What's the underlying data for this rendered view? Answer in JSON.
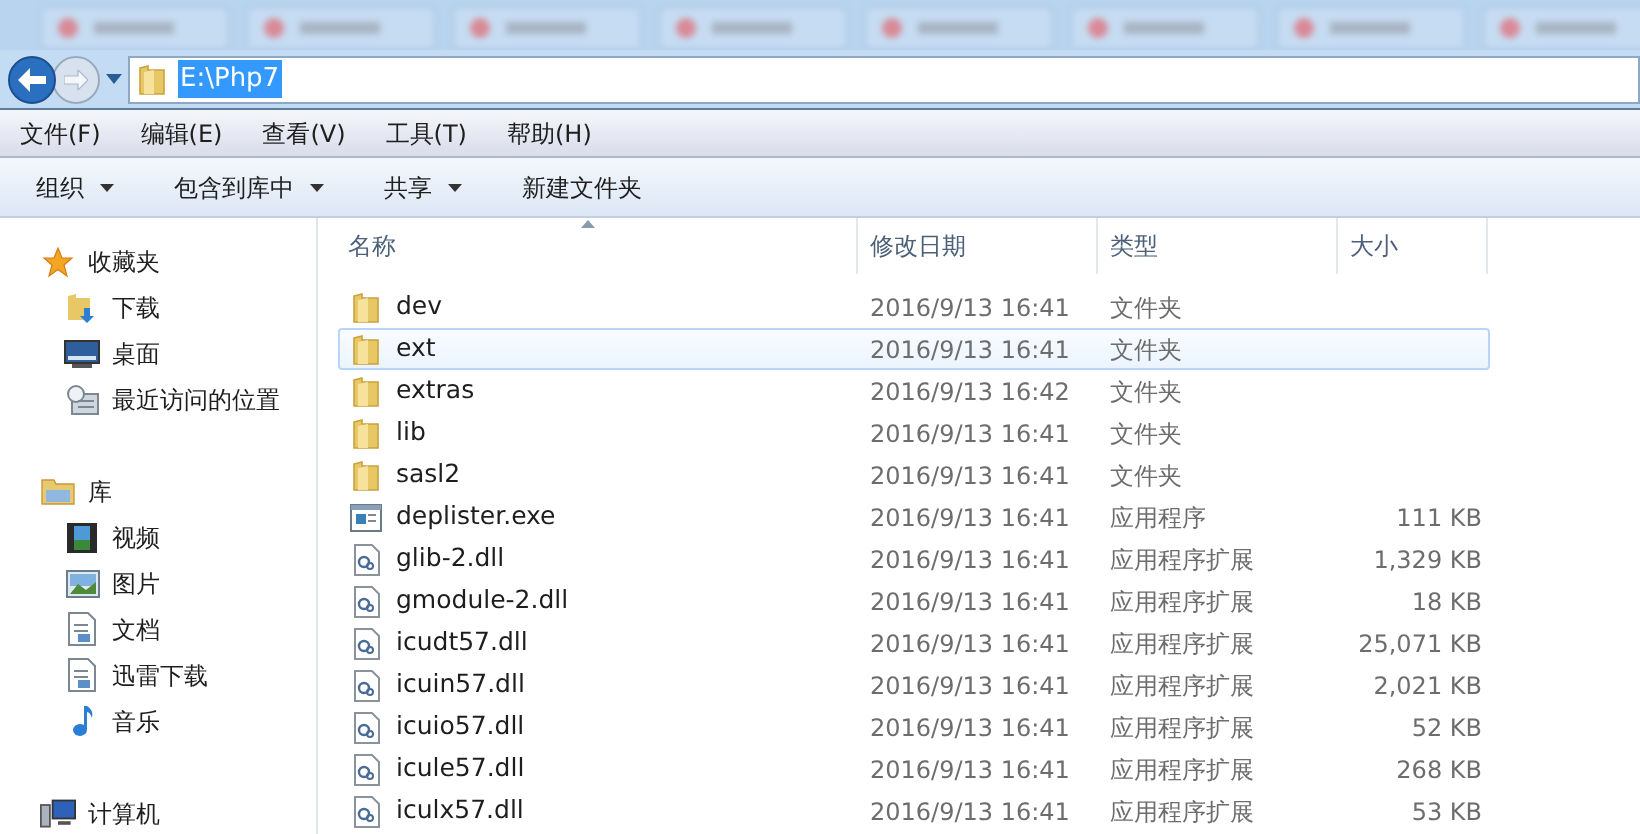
{
  "address_bar": {
    "path": "E:\\Php7",
    "selected": true
  },
  "menu": [
    "文件(F)",
    "编辑(E)",
    "查看(V)",
    "工具(T)",
    "帮助(H)"
  ],
  "toolbar": [
    {
      "label": "组织",
      "dropdown": true
    },
    {
      "label": "包含到库中",
      "dropdown": true
    },
    {
      "label": "共享",
      "dropdown": true
    },
    {
      "label": "新建文件夹",
      "dropdown": false
    }
  ],
  "navigation": [
    {
      "label": "收藏夹",
      "kind": "star",
      "children": [
        {
          "label": "下载",
          "kind": "download"
        },
        {
          "label": "桌面",
          "kind": "desktop"
        },
        {
          "label": "最近访问的位置",
          "kind": "recent"
        }
      ]
    },
    {
      "label": "库",
      "kind": "library",
      "children": [
        {
          "label": "视频",
          "kind": "video"
        },
        {
          "label": "图片",
          "kind": "image"
        },
        {
          "label": "文档",
          "kind": "document"
        },
        {
          "label": "迅雷下载",
          "kind": "document"
        },
        {
          "label": "音乐",
          "kind": "music"
        }
      ]
    },
    {
      "label": "计算机",
      "kind": "computer"
    }
  ],
  "columns": [
    {
      "label": "名称",
      "sorted": true
    },
    {
      "label": "修改日期",
      "sorted": false
    },
    {
      "label": "类型",
      "sorted": false
    },
    {
      "label": "大小",
      "sorted": false
    }
  ],
  "rows": [
    {
      "name": "dev",
      "modified": "2016/9/13 16:41",
      "type": "文件夹",
      "kind": "folder",
      "hovered": false
    },
    {
      "name": "ext",
      "modified": "2016/9/13 16:41",
      "type": "文件夹",
      "kind": "folder",
      "hovered": true
    },
    {
      "name": "extras",
      "modified": "2016/9/13 16:42",
      "type": "文件夹",
      "kind": "folder",
      "hovered": false
    },
    {
      "name": "lib",
      "modified": "2016/9/13 16:41",
      "type": "文件夹",
      "kind": "folder",
      "hovered": false
    },
    {
      "name": "sasl2",
      "modified": "2016/9/13 16:41",
      "type": "文件夹",
      "kind": "folder",
      "hovered": false
    },
    {
      "name": "deplister.exe",
      "modified": "2016/9/13 16:41",
      "type": "应用程序",
      "size": "111 KB",
      "kind": "exe",
      "hovered": false
    },
    {
      "name": "glib-2.dll",
      "modified": "2016/9/13 16:41",
      "type": "应用程序扩展",
      "size": "1,329 KB",
      "kind": "dll",
      "hovered": false
    },
    {
      "name": "gmodule-2.dll",
      "modified": "2016/9/13 16:41",
      "type": "应用程序扩展",
      "size": "18 KB",
      "kind": "dll",
      "hovered": false
    },
    {
      "name": "icudt57.dll",
      "modified": "2016/9/13 16:41",
      "type": "应用程序扩展",
      "size": "25,071 KB",
      "kind": "dll",
      "hovered": false
    },
    {
      "name": "icuin57.dll",
      "modified": "2016/9/13 16:41",
      "type": "应用程序扩展",
      "size": "2,021 KB",
      "kind": "dll",
      "hovered": false
    },
    {
      "name": "icuio57.dll",
      "modified": "2016/9/13 16:41",
      "type": "应用程序扩展",
      "size": "52 KB",
      "kind": "dll",
      "hovered": false
    },
    {
      "name": "icule57.dll",
      "modified": "2016/9/13 16:41",
      "type": "应用程序扩展",
      "size": "268 KB",
      "kind": "dll",
      "hovered": false
    },
    {
      "name": "iculx57.dll",
      "modified": "2016/9/13 16:41",
      "type": "应用程序扩展",
      "size": "53 KB",
      "kind": "dll",
      "hovered": false
    }
  ]
}
